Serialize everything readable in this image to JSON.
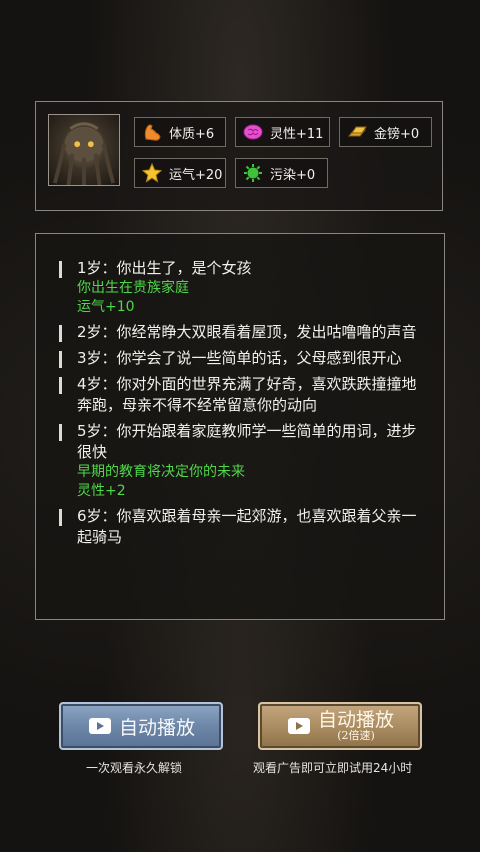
{
  "stats": [
    {
      "name": "constitution",
      "icon": "muscle-arm-icon",
      "label": "体质+6"
    },
    {
      "name": "spirit",
      "icon": "brain-icon",
      "label": "灵性+11"
    },
    {
      "name": "gold",
      "icon": "gold-bar-icon",
      "label": "金镑+0"
    },
    {
      "name": "luck",
      "icon": "star-icon",
      "label": "运气+20"
    },
    {
      "name": "corruption",
      "icon": "virus-icon",
      "label": "污染+0"
    }
  ],
  "log": [
    {
      "text": "1岁：你出生了，是个女孩",
      "extra": [
        "你出生在贵族家庭",
        "运气+10"
      ]
    },
    {
      "text": "2岁：你经常睁大双眼看着屋顶，发出咕噜噜的声音",
      "extra": []
    },
    {
      "text": "3岁：你学会了说一些简单的话，父母感到很开心",
      "extra": []
    },
    {
      "text": "4岁：你对外面的世界充满了好奇，喜欢跌跌撞撞地奔跑，母亲不得不经常留意你的动向",
      "extra": []
    },
    {
      "text": "5岁：你开始跟着家庭教师学一些简单的用词，进步很快",
      "extra": [
        "早期的教育将决定你的未来",
        "灵性+2"
      ]
    },
    {
      "text": "6岁：你喜欢跟着母亲一起郊游，也喜欢跟着父亲一起骑马",
      "extra": []
    }
  ],
  "buttons": {
    "autoplay": {
      "label": "自动播放",
      "icon": "video-camera-icon",
      "caption": "一次观看永久解锁"
    },
    "autoplay_fast": {
      "label": "自动播放",
      "sub": "(2倍速)",
      "icon": "video-camera-icon",
      "caption": "观看广告即可立即试用24小时"
    }
  },
  "colors": {
    "highlight_green": "#4fd64a",
    "button_blue": "#6d87a9",
    "button_gold": "#a98b60"
  }
}
